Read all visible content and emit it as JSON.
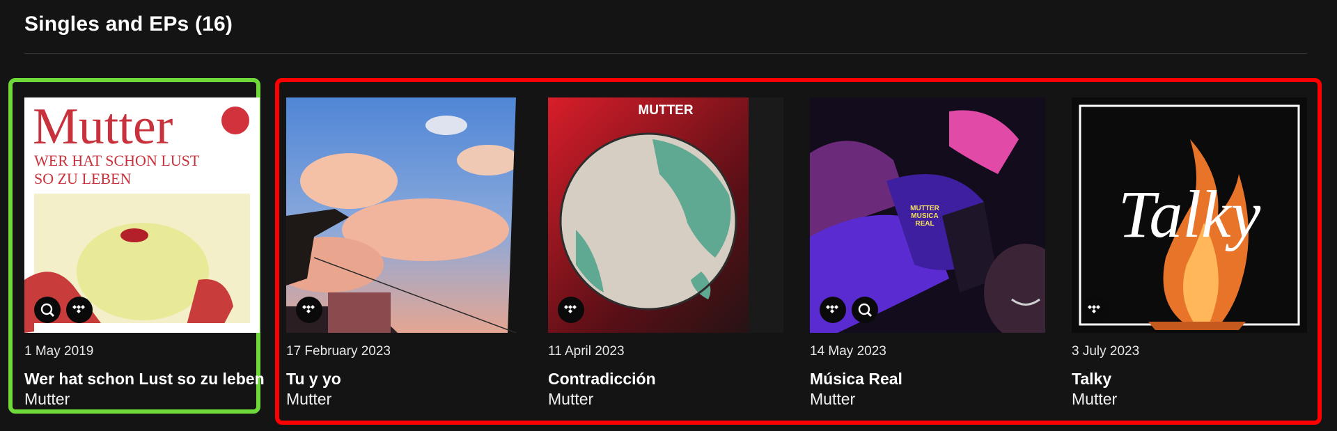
{
  "section": {
    "title": "Singles and EPs (16)"
  },
  "releases": [
    {
      "date": "1 May 2019",
      "title": "Wer hat schon Lust so zu leben",
      "artist": "Mutter",
      "badges": [
        "magnifier-icon",
        "tidal-icon"
      ],
      "cover_text": {
        "band": "Mutter",
        "line1": "WER HAT SCHON LUST",
        "line2": "SO ZU LEBEN"
      }
    },
    {
      "date": "17 February 2023",
      "title": "Tu y yo",
      "artist": "Mutter",
      "badges": [
        "tidal-icon"
      ]
    },
    {
      "date": "11 April 2023",
      "title": "Contradicción",
      "artist": "Mutter",
      "badges": [
        "tidal-icon"
      ],
      "cover_text": {
        "band": "MUTTER"
      }
    },
    {
      "date": "14 May 2023",
      "title": "Música Real",
      "artist": "Mutter",
      "badges": [
        "tidal-icon",
        "magnifier-icon"
      ],
      "cover_text": {
        "line1": "MUTTER",
        "line2": "MUSICA",
        "line3": "REAL"
      }
    },
    {
      "date": "3 July 2023",
      "title": "Talky",
      "artist": "Mutter",
      "badges": [
        "tidal-icon"
      ],
      "cover_text": {
        "word": "Talky"
      }
    }
  ],
  "colors": {
    "background": "#141414",
    "highlight_selected": "#6fd93a",
    "highlight_group": "#ff0000"
  }
}
